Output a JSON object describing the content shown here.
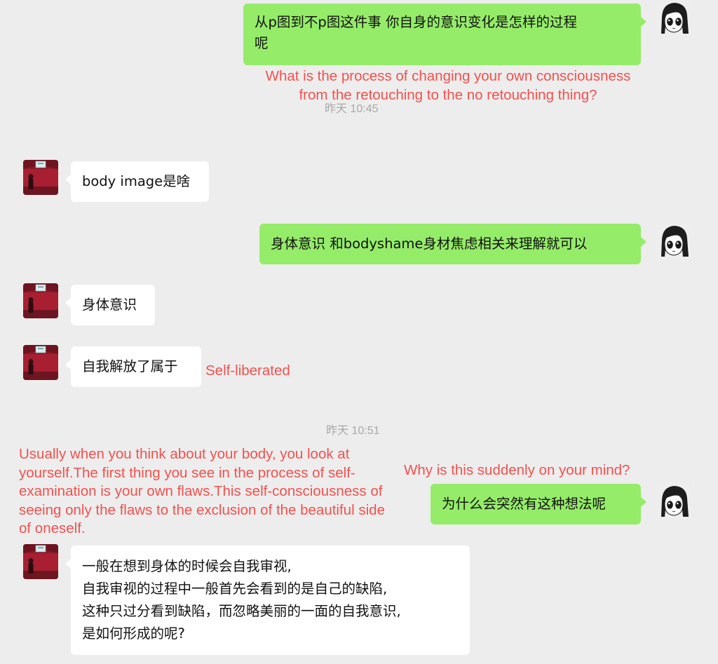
{
  "messages": {
    "m1": {
      "lines": [
        "从p图到不p图这件事 你自身的意识变化是怎样的过程",
        "呢"
      ]
    },
    "m2": {
      "text": "body image是啥"
    },
    "m3": {
      "text": "身体意识 和bodyshame身材焦虑相关来理解就可以"
    },
    "m4": {
      "text": "身体意识"
    },
    "m5": {
      "text": "自我解放了属于"
    },
    "m6": {
      "text": "为什么会突然有这种想法呢"
    },
    "m7": {
      "lines": [
        "一般在想到身体的时候会自我审视,",
        "自我审视的过程中一般首先会看到的是自己的缺陷,",
        "这种只过分看到缺陷，而忽略美丽的一面的自我意识,",
        "是如何形成的呢?"
      ]
    }
  },
  "translations": {
    "t1": {
      "lines": [
        "What is the process of changing your own consciousness",
        "from the retouching to the no retouching thing?"
      ]
    },
    "t2": {
      "text": "Self-liberated"
    },
    "t3": {
      "text": "Why is this suddenly on your mind?"
    },
    "t4": {
      "lines": [
        "Usually when you think about your body, you look at",
        "yourself.The first thing you see in the process of self-",
        "examination is your own flaws.This self-consciousness of",
        "seeing only the flaws to the exclusion of the beautiful side",
        "of oneself."
      ]
    }
  },
  "timestamps": {
    "ts1": "昨天 10:45",
    "ts2": "昨天 10:51"
  },
  "icons": {
    "self_avatar": "cartoon-girl-avatar-icon",
    "contact_avatar": "red-room-avatar-icon"
  },
  "colors": {
    "background": "#ededed",
    "sent_bubble": "#95ec69",
    "received_bubble": "#ffffff",
    "translation_text": "#f2514d",
    "timestamp_text": "#a8a8a8"
  }
}
